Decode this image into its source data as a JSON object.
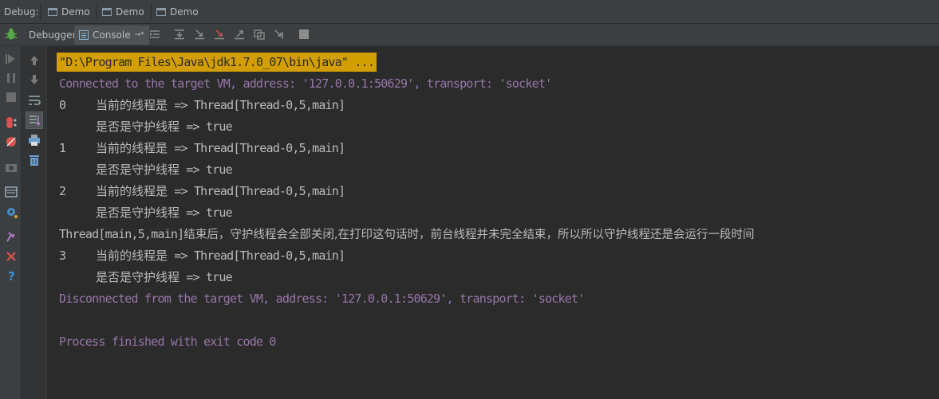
{
  "top_bar": {
    "debug_label": "Debug:",
    "run_tabs": [
      {
        "label": "Demo"
      },
      {
        "label": "Demo"
      },
      {
        "label": "Demo"
      }
    ]
  },
  "toolbar": {
    "debugger_tab": "Debugger",
    "console_tab": "Console",
    "console_tab_suffix": "→*"
  },
  "console": {
    "command_line": "\"D:\\Program Files\\Java\\jdk1.7.0_07\\bin\\java\" ...",
    "connected_line": "Connected to the target VM, address: '127.0.0.1:50629', transport: 'socket'",
    "entries": [
      {
        "index": "0",
        "thread_label": "当前的线程是",
        "thread_value": " => Thread[Thread-0,5,main]",
        "daemon_label": "是否是守护线程",
        "daemon_value": " => true"
      },
      {
        "index": "1",
        "thread_label": "当前的线程是",
        "thread_value": " => Thread[Thread-0,5,main]",
        "daemon_label": "是否是守护线程",
        "daemon_value": " => true"
      },
      {
        "index": "2",
        "thread_label": "当前的线程是",
        "thread_value": " => Thread[Thread-0,5,main]",
        "daemon_label": "是否是守护线程",
        "daemon_value": " => true"
      }
    ],
    "main_end_prefix": "Thread[main,5,main]",
    "main_end_text": "结束后，守护线程会全部关闭,在打印这句话时，前台线程并未完全结束，所以所以守护线程还是会运行一段时间",
    "last_entry": {
      "index": "3",
      "thread_label": "当前的线程是",
      "thread_value": " => Thread[Thread-0,5,main]",
      "daemon_label": "是否是守护线程",
      "daemon_value": " => true"
    },
    "disconnected_line": "Disconnected from the target VM, address: '127.0.0.1:50629', transport: 'socket'",
    "finished_line": "Process finished with exit code 0"
  },
  "colors": {
    "background": "#2b2b2b",
    "panel": "#3c3f41",
    "command_highlight": "#d39f00",
    "vm_message": "#9876aa",
    "output_text": "#bbbbbb"
  }
}
